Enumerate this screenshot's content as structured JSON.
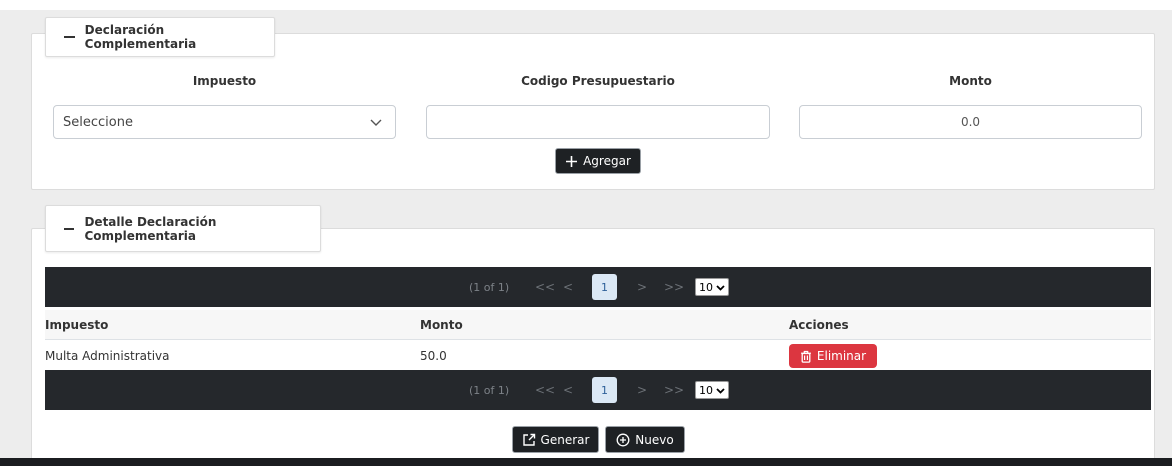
{
  "section1": {
    "legend": "Declaración Complementaria",
    "headers": {
      "impuesto": "Impuesto",
      "codigo": "Codigo Presupuestario",
      "monto": "Monto"
    },
    "impuesto_select": {
      "value": "Seleccione"
    },
    "codigo_input": {
      "value": ""
    },
    "monto_input": {
      "value": "0.0"
    },
    "add_button": {
      "icon": "plus-icon",
      "label": "Agregar"
    }
  },
  "section2": {
    "legend": "Detalle Declaración Complementaria",
    "paginator": {
      "info": "(1 of 1)",
      "first": "<<",
      "prev": "<",
      "current_page": "1",
      "next": ">",
      "last": ">>",
      "rows_per_page": "10"
    },
    "table": {
      "columns": [
        "Impuesto",
        "Monto",
        "Acciones"
      ],
      "rows": [
        {
          "impuesto": "Multa Administrativa",
          "monto": "50.0",
          "action_label": "Eliminar",
          "action_icon": "trash-icon"
        }
      ]
    },
    "buttons": {
      "generar": {
        "icon": "export-icon",
        "label": "Generar"
      },
      "nuevo": {
        "icon": "plus-circle-icon",
        "label": "Nuevo"
      }
    }
  },
  "colors": {
    "dark": "#25282c",
    "danger": "#dc3640",
    "page_active": "#dbe8f5"
  }
}
